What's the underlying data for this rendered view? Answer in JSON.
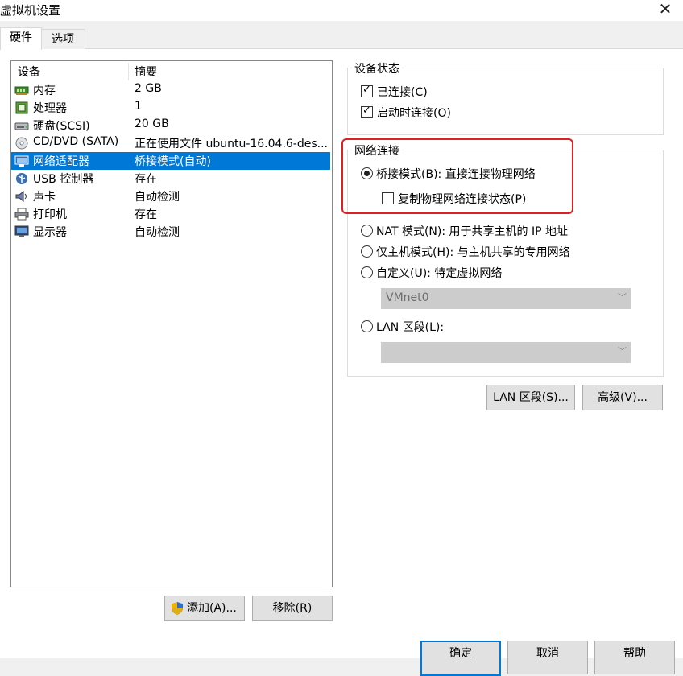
{
  "window": {
    "title": "虚拟机设置",
    "close_glyph": "✕"
  },
  "tabs": [
    {
      "label": "硬件"
    },
    {
      "label": "选项"
    }
  ],
  "device_list": {
    "col_device": "设备",
    "col_summary": "摘要",
    "items": [
      {
        "icon": "memory-icon",
        "name": "内存",
        "summary": "2 GB"
      },
      {
        "icon": "processor-icon",
        "name": "处理器",
        "summary": "1"
      },
      {
        "icon": "hard-disk-icon",
        "name": "硬盘(SCSI)",
        "summary": "20 GB"
      },
      {
        "icon": "cd-dvd-icon",
        "name": "CD/DVD (SATA)",
        "summary": "正在使用文件 ubuntu-16.04.6-des..."
      },
      {
        "icon": "network-adapter-icon",
        "name": "网络适配器",
        "summary": "桥接模式(自动)"
      },
      {
        "icon": "usb-icon",
        "name": "USB 控制器",
        "summary": "存在"
      },
      {
        "icon": "sound-card-icon",
        "name": "声卡",
        "summary": "自动检测"
      },
      {
        "icon": "printer-icon",
        "name": "打印机",
        "summary": "存在"
      },
      {
        "icon": "display-icon",
        "name": "显示器",
        "summary": "自动检测"
      }
    ],
    "selected_index": 4
  },
  "buttons": {
    "add": "添加(A)...",
    "remove": "移除(R)",
    "ok": "确定",
    "cancel": "取消",
    "help": "帮助",
    "lan_segments": "LAN 区段(S)...",
    "advanced": "高级(V)..."
  },
  "device_status": {
    "title": "设备状态",
    "connected": {
      "label": "已连接(C)",
      "checked": true
    },
    "connect_at_power_on": {
      "label": "启动时连接(O)",
      "checked": true
    }
  },
  "network_connection": {
    "title": "网络连接",
    "bridged": {
      "label": "桥接模式(B): 直接连接物理网络",
      "selected": true
    },
    "replicate": {
      "label": "复制物理网络连接状态(P)",
      "checked": false
    },
    "nat": {
      "label": "NAT 模式(N): 用于共享主机的 IP 地址",
      "selected": false
    },
    "host_only": {
      "label": "仅主机模式(H): 与主机共享的专用网络",
      "selected": false
    },
    "custom": {
      "label": "自定义(U): 特定虚拟网络",
      "selected": false
    },
    "custom_select_value": "VMnet0",
    "lan_segment": {
      "label": "LAN 区段(L):",
      "selected": false
    },
    "lan_select_value": ""
  },
  "colors": {
    "selection": "#0078d7",
    "highlight_box": "#e02020"
  }
}
